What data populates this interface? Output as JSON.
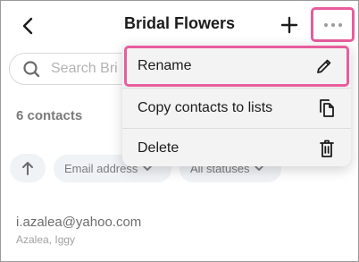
{
  "header": {
    "title": "Bridal Flowers",
    "back_icon": "chevron-left-icon",
    "add_icon": "plus-icon",
    "more_icon": "more-horizontal-icon"
  },
  "search": {
    "placeholder": "Search Bri",
    "icon": "search-icon"
  },
  "contacts_count": "6 contacts",
  "filters": {
    "sort_icon": "arrow-up-icon",
    "email_chip": "Email address",
    "status_chip": "All statuses"
  },
  "contact": {
    "email": "i.azalea@yahoo.com",
    "name": "Azalea, Iggy"
  },
  "menu": {
    "items": [
      {
        "label": "Rename",
        "icon": "pencil-icon"
      },
      {
        "label": "Copy contacts to lists",
        "icon": "copy-icon"
      },
      {
        "label": "Delete",
        "icon": "trash-icon"
      }
    ]
  },
  "colors": {
    "highlight": "#e85d9d",
    "chip_bg": "#e9edf1",
    "menu_bg": "#f3f3f3"
  }
}
